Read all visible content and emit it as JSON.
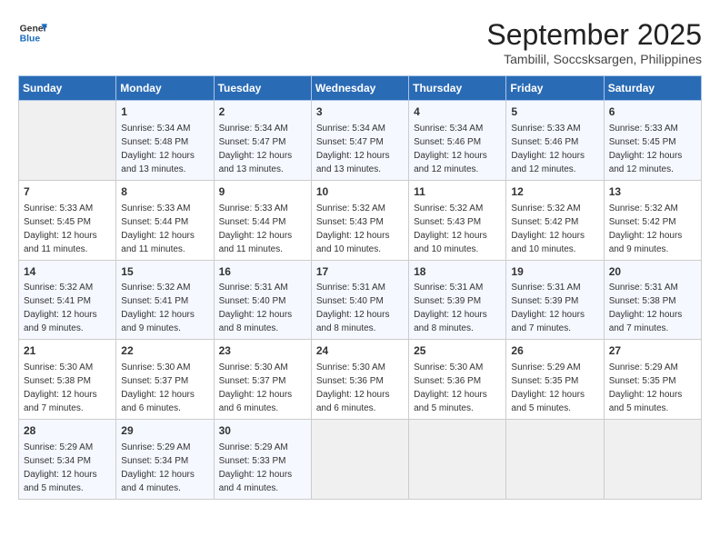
{
  "header": {
    "logo_line1": "General",
    "logo_line2": "Blue",
    "month": "September 2025",
    "location": "Tambilil, Soccsksargen, Philippines"
  },
  "weekdays": [
    "Sunday",
    "Monday",
    "Tuesday",
    "Wednesday",
    "Thursday",
    "Friday",
    "Saturday"
  ],
  "weeks": [
    [
      {
        "day": "",
        "info": ""
      },
      {
        "day": "1",
        "info": "Sunrise: 5:34 AM\nSunset: 5:48 PM\nDaylight: 12 hours\nand 13 minutes."
      },
      {
        "day": "2",
        "info": "Sunrise: 5:34 AM\nSunset: 5:47 PM\nDaylight: 12 hours\nand 13 minutes."
      },
      {
        "day": "3",
        "info": "Sunrise: 5:34 AM\nSunset: 5:47 PM\nDaylight: 12 hours\nand 13 minutes."
      },
      {
        "day": "4",
        "info": "Sunrise: 5:34 AM\nSunset: 5:46 PM\nDaylight: 12 hours\nand 12 minutes."
      },
      {
        "day": "5",
        "info": "Sunrise: 5:33 AM\nSunset: 5:46 PM\nDaylight: 12 hours\nand 12 minutes."
      },
      {
        "day": "6",
        "info": "Sunrise: 5:33 AM\nSunset: 5:45 PM\nDaylight: 12 hours\nand 12 minutes."
      }
    ],
    [
      {
        "day": "7",
        "info": "Sunrise: 5:33 AM\nSunset: 5:45 PM\nDaylight: 12 hours\nand 11 minutes."
      },
      {
        "day": "8",
        "info": "Sunrise: 5:33 AM\nSunset: 5:44 PM\nDaylight: 12 hours\nand 11 minutes."
      },
      {
        "day": "9",
        "info": "Sunrise: 5:33 AM\nSunset: 5:44 PM\nDaylight: 12 hours\nand 11 minutes."
      },
      {
        "day": "10",
        "info": "Sunrise: 5:32 AM\nSunset: 5:43 PM\nDaylight: 12 hours\nand 10 minutes."
      },
      {
        "day": "11",
        "info": "Sunrise: 5:32 AM\nSunset: 5:43 PM\nDaylight: 12 hours\nand 10 minutes."
      },
      {
        "day": "12",
        "info": "Sunrise: 5:32 AM\nSunset: 5:42 PM\nDaylight: 12 hours\nand 10 minutes."
      },
      {
        "day": "13",
        "info": "Sunrise: 5:32 AM\nSunset: 5:42 PM\nDaylight: 12 hours\nand 9 minutes."
      }
    ],
    [
      {
        "day": "14",
        "info": "Sunrise: 5:32 AM\nSunset: 5:41 PM\nDaylight: 12 hours\nand 9 minutes."
      },
      {
        "day": "15",
        "info": "Sunrise: 5:32 AM\nSunset: 5:41 PM\nDaylight: 12 hours\nand 9 minutes."
      },
      {
        "day": "16",
        "info": "Sunrise: 5:31 AM\nSunset: 5:40 PM\nDaylight: 12 hours\nand 8 minutes."
      },
      {
        "day": "17",
        "info": "Sunrise: 5:31 AM\nSunset: 5:40 PM\nDaylight: 12 hours\nand 8 minutes."
      },
      {
        "day": "18",
        "info": "Sunrise: 5:31 AM\nSunset: 5:39 PM\nDaylight: 12 hours\nand 8 minutes."
      },
      {
        "day": "19",
        "info": "Sunrise: 5:31 AM\nSunset: 5:39 PM\nDaylight: 12 hours\nand 7 minutes."
      },
      {
        "day": "20",
        "info": "Sunrise: 5:31 AM\nSunset: 5:38 PM\nDaylight: 12 hours\nand 7 minutes."
      }
    ],
    [
      {
        "day": "21",
        "info": "Sunrise: 5:30 AM\nSunset: 5:38 PM\nDaylight: 12 hours\nand 7 minutes."
      },
      {
        "day": "22",
        "info": "Sunrise: 5:30 AM\nSunset: 5:37 PM\nDaylight: 12 hours\nand 6 minutes."
      },
      {
        "day": "23",
        "info": "Sunrise: 5:30 AM\nSunset: 5:37 PM\nDaylight: 12 hours\nand 6 minutes."
      },
      {
        "day": "24",
        "info": "Sunrise: 5:30 AM\nSunset: 5:36 PM\nDaylight: 12 hours\nand 6 minutes."
      },
      {
        "day": "25",
        "info": "Sunrise: 5:30 AM\nSunset: 5:36 PM\nDaylight: 12 hours\nand 5 minutes."
      },
      {
        "day": "26",
        "info": "Sunrise: 5:29 AM\nSunset: 5:35 PM\nDaylight: 12 hours\nand 5 minutes."
      },
      {
        "day": "27",
        "info": "Sunrise: 5:29 AM\nSunset: 5:35 PM\nDaylight: 12 hours\nand 5 minutes."
      }
    ],
    [
      {
        "day": "28",
        "info": "Sunrise: 5:29 AM\nSunset: 5:34 PM\nDaylight: 12 hours\nand 5 minutes."
      },
      {
        "day": "29",
        "info": "Sunrise: 5:29 AM\nSunset: 5:34 PM\nDaylight: 12 hours\nand 4 minutes."
      },
      {
        "day": "30",
        "info": "Sunrise: 5:29 AM\nSunset: 5:33 PM\nDaylight: 12 hours\nand 4 minutes."
      },
      {
        "day": "",
        "info": ""
      },
      {
        "day": "",
        "info": ""
      },
      {
        "day": "",
        "info": ""
      },
      {
        "day": "",
        "info": ""
      }
    ]
  ]
}
